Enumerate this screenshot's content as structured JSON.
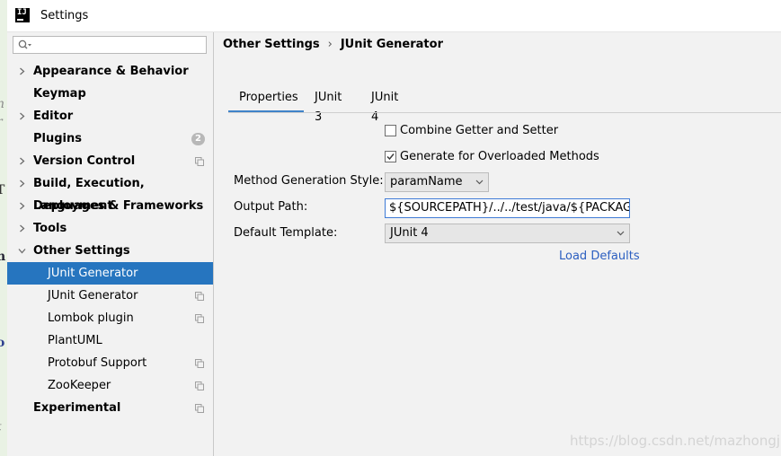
{
  "window": {
    "title": "Settings",
    "logo_text": "IJ"
  },
  "background_glyphs": [
    "n",
    "r",
    "T",
    "n",
    "o",
    "t"
  ],
  "search": {
    "placeholder": "",
    "value": ""
  },
  "sidebar": {
    "items": [
      {
        "label": "Appearance & Behavior",
        "expandable": true
      },
      {
        "label": "Keymap",
        "expandable": false
      },
      {
        "label": "Editor",
        "expandable": true
      },
      {
        "label": "Plugins",
        "expandable": false,
        "badge": "2"
      },
      {
        "label": "Version Control",
        "expandable": true,
        "icon": "copy-icon"
      },
      {
        "label": "Build, Execution, Deployment",
        "expandable": true
      },
      {
        "label": "Languages & Frameworks",
        "expandable": true
      },
      {
        "label": "Tools",
        "expandable": true
      },
      {
        "label": "Other Settings",
        "expandable": true,
        "expanded": true
      },
      {
        "label": "JUnit Generator",
        "child": true,
        "selected": true
      },
      {
        "label": "JUnit Generator",
        "child": true,
        "icon": "copy-icon"
      },
      {
        "label": "Lombok plugin",
        "child": true,
        "icon": "copy-icon"
      },
      {
        "label": "PlantUML",
        "child": true
      },
      {
        "label": "Protobuf Support",
        "child": true,
        "icon": "copy-icon"
      },
      {
        "label": "ZooKeeper",
        "child": true,
        "icon": "copy-icon"
      },
      {
        "label": "Experimental",
        "expandable": false,
        "icon": "copy-icon"
      }
    ]
  },
  "breadcrumb": {
    "parent": "Other Settings",
    "separator": "›",
    "current": "JUnit Generator"
  },
  "tabs": [
    {
      "label": "Properties",
      "active": true
    },
    {
      "label": "JUnit 3",
      "active": false
    },
    {
      "label": "JUnit 4",
      "active": false
    }
  ],
  "options": {
    "combine_getter_setter": {
      "label": "Combine Getter and Setter",
      "checked": false
    },
    "generate_overloaded": {
      "label": "Generate for Overloaded Methods",
      "checked": true
    }
  },
  "fields": {
    "method_style": {
      "label": "Method Generation Style:",
      "value": "paramName"
    },
    "output_path": {
      "label": "Output Path:",
      "value": "${SOURCEPATH}/../../test/java/${PACKAGE}/${"
    },
    "default_template": {
      "label": "Default Template:",
      "value": "JUnit 4"
    }
  },
  "load_defaults": "Load Defaults",
  "watermark": "https://blog.csdn.net/mazhongjia",
  "colors": {
    "selection": "#2675bf",
    "accent": "#4083c9",
    "link": "#2b5ec0"
  }
}
